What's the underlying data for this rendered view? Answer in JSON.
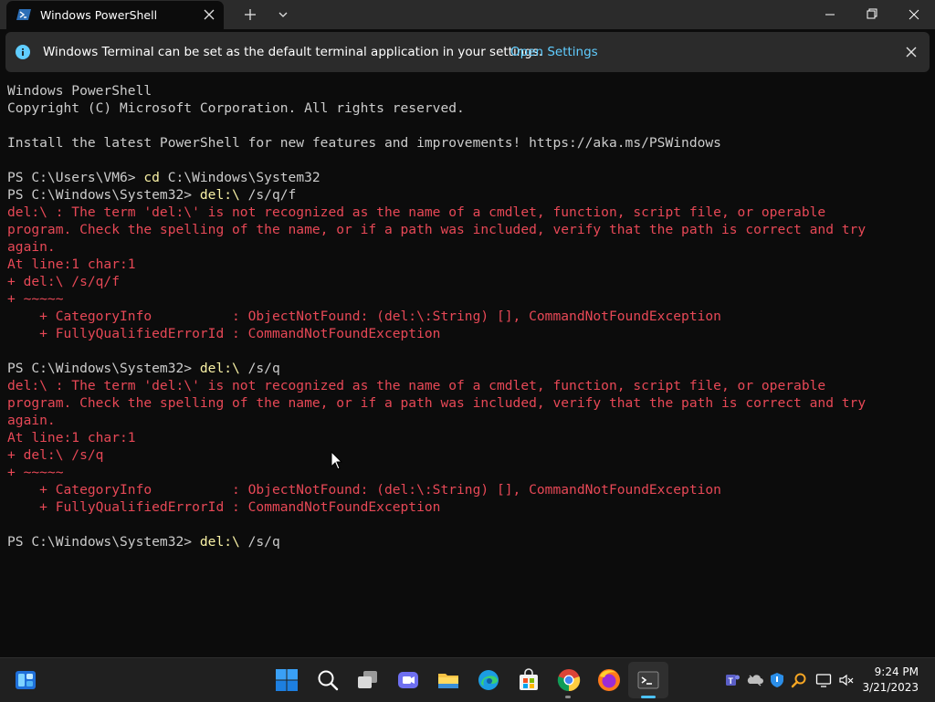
{
  "window": {
    "tab_title": "Windows PowerShell"
  },
  "infobar": {
    "message": "Windows Terminal can be set as the default terminal application in your settings.",
    "link": "Open Settings"
  },
  "terminal": {
    "lines": [
      {
        "type": "n",
        "text": "Windows PowerShell"
      },
      {
        "type": "n",
        "text": "Copyright (C) Microsoft Corporation. All rights reserved."
      },
      {
        "type": "n",
        "text": ""
      },
      {
        "type": "n",
        "text": "Install the latest PowerShell for new features and improvements! https://aka.ms/PSWindows"
      },
      {
        "type": "n",
        "text": ""
      },
      {
        "type": "p",
        "prompt": "PS C:\\Users\\VM6> ",
        "cmd": "cd",
        "rest": " C:\\Windows\\System32"
      },
      {
        "type": "p",
        "prompt": "PS C:\\Windows\\System32> ",
        "cmd": "del:\\",
        "rest": " /s/q/f"
      },
      {
        "type": "e",
        "text": "del:\\ : The term 'del:\\' is not recognized as the name of a cmdlet, function, script file, or operable"
      },
      {
        "type": "e",
        "text": "program. Check the spelling of the name, or if a path was included, verify that the path is correct and try"
      },
      {
        "type": "e",
        "text": "again."
      },
      {
        "type": "e",
        "text": "At line:1 char:1"
      },
      {
        "type": "e",
        "text": "+ del:\\ /s/q/f"
      },
      {
        "type": "e",
        "text": "+ ~~~~~"
      },
      {
        "type": "e",
        "text": "    + CategoryInfo          : ObjectNotFound: (del:\\:String) [], CommandNotFoundException"
      },
      {
        "type": "e",
        "text": "    + FullyQualifiedErrorId : CommandNotFoundException"
      },
      {
        "type": "n",
        "text": ""
      },
      {
        "type": "p",
        "prompt": "PS C:\\Windows\\System32> ",
        "cmd": "del:\\",
        "rest": " /s/q"
      },
      {
        "type": "e",
        "text": "del:\\ : The term 'del:\\' is not recognized as the name of a cmdlet, function, script file, or operable"
      },
      {
        "type": "e",
        "text": "program. Check the spelling of the name, or if a path was included, verify that the path is correct and try"
      },
      {
        "type": "e",
        "text": "again."
      },
      {
        "type": "e",
        "text": "At line:1 char:1"
      },
      {
        "type": "e",
        "text": "+ del:\\ /s/q"
      },
      {
        "type": "e",
        "text": "+ ~~~~~"
      },
      {
        "type": "e",
        "text": "    + CategoryInfo          : ObjectNotFound: (del:\\:String) [], CommandNotFoundException"
      },
      {
        "type": "e",
        "text": "    + FullyQualifiedErrorId : CommandNotFoundException"
      },
      {
        "type": "n",
        "text": ""
      },
      {
        "type": "p",
        "prompt": "PS C:\\Windows\\System32> ",
        "cmd": "del:\\",
        "rest": " /s/q"
      }
    ]
  },
  "taskbar": {
    "apps": [
      "widgets-icon",
      "start-icon",
      "search-icon",
      "task-view-icon",
      "teams-chat-icon",
      "file-explorer-icon",
      "edge-icon",
      "store-icon",
      "chrome-icon",
      "firefox-icon",
      "terminal-icon"
    ],
    "tray": [
      "teams-icon",
      "onedrive-icon",
      "security-icon",
      "search-tray-icon",
      "display-icon",
      "volume-muted-icon"
    ],
    "time": "9:24 PM",
    "date": "3/21/2023"
  },
  "colors": {
    "background": "#0c0c0c",
    "text": "#cccccc",
    "error": "#e74856",
    "command": "#f9f1a5",
    "link": "#60cdff"
  }
}
